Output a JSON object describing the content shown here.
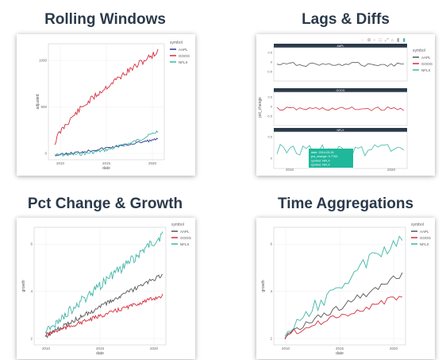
{
  "cards": [
    {
      "title": "Rolling Windows",
      "legend_title": "symbol",
      "series": [
        {
          "name": "AAPL",
          "color": "#2e3a8c"
        },
        {
          "name": "GOOG",
          "color": "#d62c3c"
        },
        {
          "name": "NFLX",
          "color": "#3fb6a8"
        }
      ],
      "xlabel": "date",
      "ylabel": "adjusted",
      "xticks": [
        "2010",
        "2015",
        "2020"
      ],
      "yticks": [
        "0",
        "500",
        "1000"
      ]
    },
    {
      "title": "Lags & Diffs",
      "legend_title": "symbol",
      "series": [
        {
          "name": "AAPL",
          "color": "#555555"
        },
        {
          "name": "GOOG",
          "color": "#d62c3c"
        },
        {
          "name": "NFLX",
          "color": "#3fb6a8"
        }
      ],
      "panel_titles": [
        "AAPL",
        "GOOG",
        "NFLX"
      ],
      "ylabel": "pct_change",
      "xticks": [
        "2010",
        "2020"
      ],
      "panel_yticks": [
        [
          "0.5",
          "0",
          "-0.5"
        ],
        [
          "0.5",
          "0",
          "-0.5"
        ],
        [
          "0.5",
          "0"
        ]
      ],
      "tooltip": [
        "date: 2014-05-01",
        "pct_change: 0.7763",
        "symbol: NFLX",
        "symbol: NFLX"
      ]
    },
    {
      "title": "Pct Change & Growth",
      "legend_title": "symbol",
      "series": [
        {
          "name": "AAPL",
          "color": "#555555"
        },
        {
          "name": "GOOG",
          "color": "#d62c3c"
        },
        {
          "name": "NFLX",
          "color": "#3fb6a8"
        }
      ],
      "xlabel": "date",
      "ylabel": "growth",
      "xticks": [
        "2010",
        "2015",
        "2020"
      ],
      "yticks": [
        "2",
        "4",
        "6"
      ]
    },
    {
      "title": "Time Aggregations",
      "legend_title": "symbol",
      "series": [
        {
          "name": "AAPL",
          "color": "#555555"
        },
        {
          "name": "GOOG",
          "color": "#d62c3c"
        },
        {
          "name": "NFLX",
          "color": "#3fb6a8"
        }
      ],
      "xlabel": "date",
      "ylabel": "growth",
      "xticks": [
        "2010",
        "2015",
        "2020"
      ],
      "yticks": [
        "2",
        "4",
        "6"
      ]
    }
  ]
}
